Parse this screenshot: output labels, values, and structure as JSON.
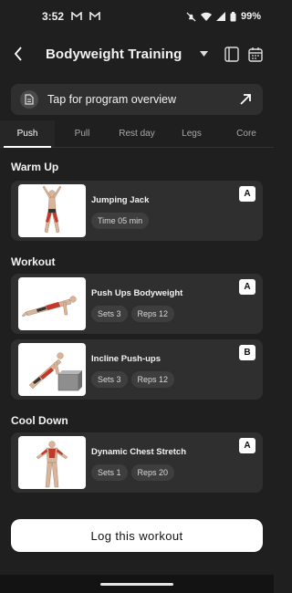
{
  "status": {
    "time": "3:52",
    "battery": "99%"
  },
  "header": {
    "title": "Bodyweight Training"
  },
  "overview": {
    "label": "Tap for program overview"
  },
  "tabs": [
    {
      "label": "Push",
      "active": true
    },
    {
      "label": "Pull",
      "active": false
    },
    {
      "label": "Rest day",
      "active": false
    },
    {
      "label": "Legs",
      "active": false
    },
    {
      "label": "Core",
      "active": false
    }
  ],
  "sections": {
    "warmup": {
      "title": "Warm Up",
      "items": [
        {
          "name": "Jumping Jack",
          "chips": [
            "Time 05 min"
          ],
          "badge": "A"
        }
      ]
    },
    "workout": {
      "title": "Workout",
      "items": [
        {
          "name": "Push Ups Bodyweight",
          "chips": [
            "Sets 3",
            "Reps 12"
          ],
          "badge": "A"
        },
        {
          "name": "Incline Push-ups",
          "chips": [
            "Sets 3",
            "Reps 12"
          ],
          "badge": "B"
        }
      ]
    },
    "cooldown": {
      "title": "Cool Down",
      "items": [
        {
          "name": "Dynamic Chest Stretch",
          "chips": [
            "Sets 1",
            "Reps 20"
          ],
          "badge": "A"
        }
      ]
    }
  },
  "footer": {
    "log_button": "Log this workout"
  },
  "colors": {
    "background": "#1f1f1f",
    "card": "#2f2f2f",
    "chip": "#3e3e3e",
    "accent_muscle": "#c0392b",
    "button": "#ffffff"
  },
  "icons": [
    "back-arrow-icon",
    "dropdown-caret-icon",
    "notebook-icon",
    "calendar-icon",
    "document-icon",
    "arrow-up-right-icon",
    "gmail-icon",
    "mute-icon",
    "wifi-icon",
    "signal-icon",
    "battery-icon"
  ]
}
